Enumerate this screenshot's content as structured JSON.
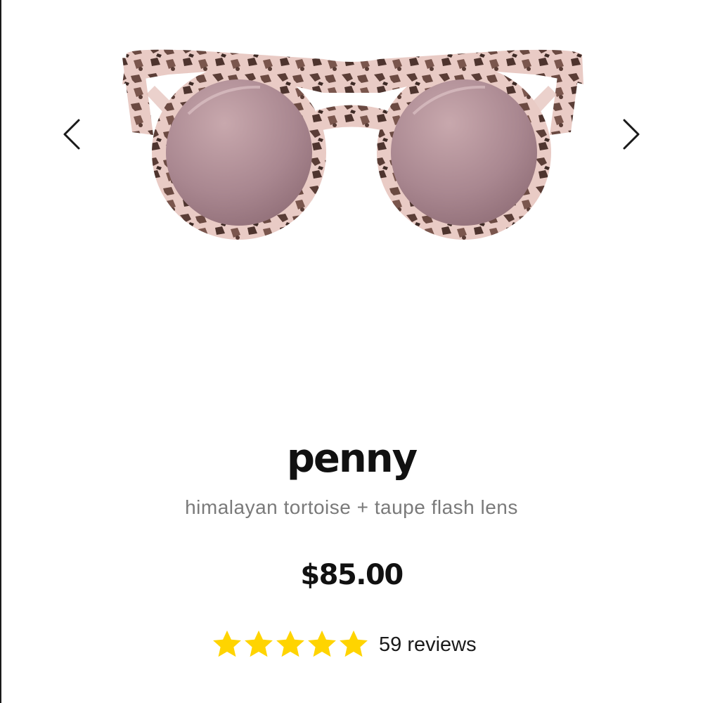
{
  "product": {
    "name": "penny",
    "variant": "himalayan tortoise + taupe flash lens",
    "price": "$85.00",
    "image_icon": "sunglasses-product-image"
  },
  "carousel": {
    "prev_icon": "chevron-left-icon",
    "next_icon": "chevron-right-icon"
  },
  "rating": {
    "stars": 5,
    "max_stars": 5,
    "review_text": "59 reviews",
    "star_color": "#FFD400"
  },
  "colors": {
    "frame": "#e8c9c3",
    "lens": "#a77f86",
    "text_primary": "#111111",
    "text_secondary": "#7a7a7a"
  }
}
